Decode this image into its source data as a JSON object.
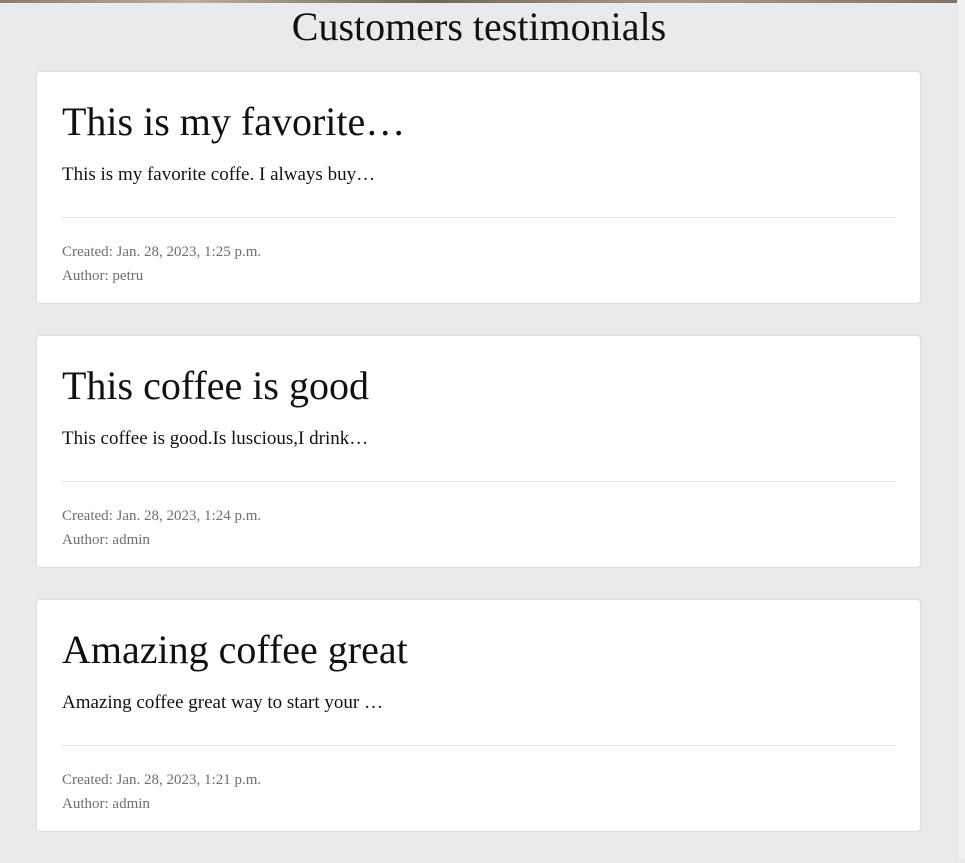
{
  "page": {
    "title": "Customers testimonials"
  },
  "testimonials": [
    {
      "title": "This is my favorite…",
      "excerpt": "This is my favorite coffe. I always buy…",
      "created": "Created: Jan. 28, 2023, 1:25 p.m.",
      "author": "Author: petru"
    },
    {
      "title": "This coffee is good",
      "excerpt": "This coffee is good.Is luscious,I drink…",
      "created": "Created: Jan. 28, 2023, 1:24 p.m.",
      "author": "Author: admin"
    },
    {
      "title": "Amazing coffee great",
      "excerpt": "Amazing coffee great way to start your …",
      "created": "Created: Jan. 28, 2023, 1:21 p.m.",
      "author": "Author: admin"
    }
  ]
}
